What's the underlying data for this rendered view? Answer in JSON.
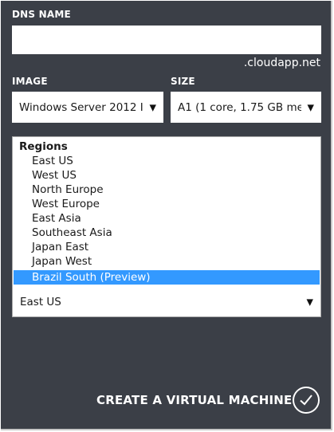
{
  "dns": {
    "label": "DNS NAME",
    "value": "",
    "suffix": ".cloudapp.net"
  },
  "image": {
    "label": "IMAGE",
    "selected": "Windows Server 2012 I"
  },
  "size": {
    "label": "SIZE",
    "selected": "A1 (1 core, 1.75 GB me"
  },
  "region": {
    "group_label": "Regions",
    "options": [
      "East US",
      "West US",
      "North Europe",
      "West Europe",
      "East Asia",
      "Southeast Asia",
      "Japan East",
      "Japan West",
      "Brazil South (Preview)"
    ],
    "highlighted": "Brazil South (Preview)",
    "selected": "East US"
  },
  "create": {
    "label": "CREATE A VIRTUAL MACHINE"
  },
  "icons": {
    "dropdown_arrow": "▼",
    "confirm": "check-icon"
  },
  "colors": {
    "panel_bg": "#3b3f47",
    "highlight": "#3399ff"
  }
}
